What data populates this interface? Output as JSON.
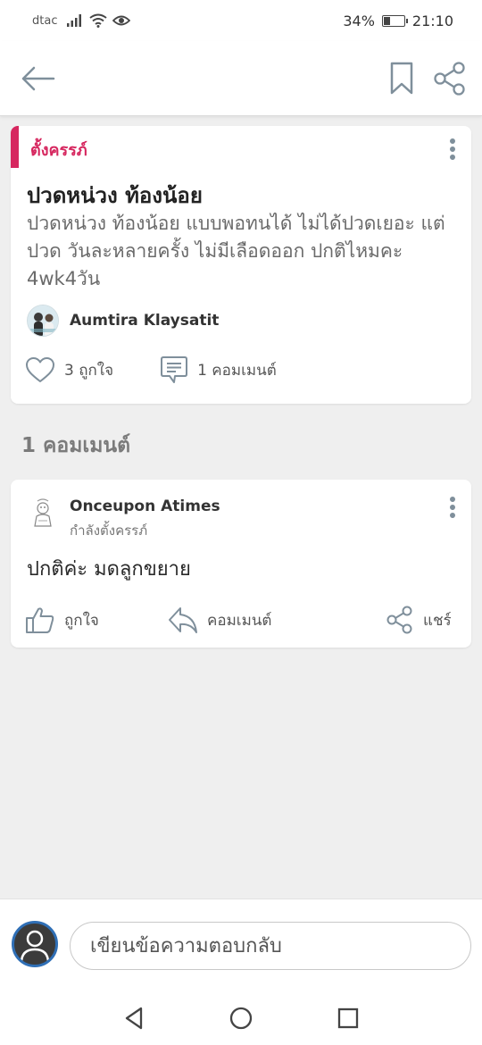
{
  "status_bar": {
    "carrier": "dtac",
    "battery_percent": "34%",
    "battery_level": 0.34,
    "time": "21:10"
  },
  "app_bar": {
    "icons": [
      "back-arrow-icon",
      "bookmark-icon",
      "share-icon"
    ]
  },
  "post": {
    "tag": "ตั้งครรภ์",
    "title": "ปวดหน่วง ท้องน้อย",
    "body": "ปวดหน่วง ท้องน้อย แบบพอทนได้ ไม่ได้ปวดเยอะ  แต่ปวด วันละหลายครั้ง ไม่มีเลือดออก ปกติไหมคะ 4wk4วัน",
    "author": "Aumtira Klaysatit",
    "likes_label": "3 ถูกใจ",
    "comments_label": "1 คอมเมนต์"
  },
  "comments_heading": "1 คอมเมนต์",
  "comment": {
    "author": "Onceupon Atimes",
    "status": "กำลังตั้งครรภ์",
    "text": "ปกติค่ะ มดลูกขยาย",
    "like_label": "ถูกใจ",
    "reply_label": "คอมเมนต์",
    "share_label": "แชร์"
  },
  "reply": {
    "placeholder": "เขียนข้อความตอบกลับ"
  },
  "colors": {
    "accent": "#d6275f",
    "icon_gray": "#7f8f9b"
  }
}
